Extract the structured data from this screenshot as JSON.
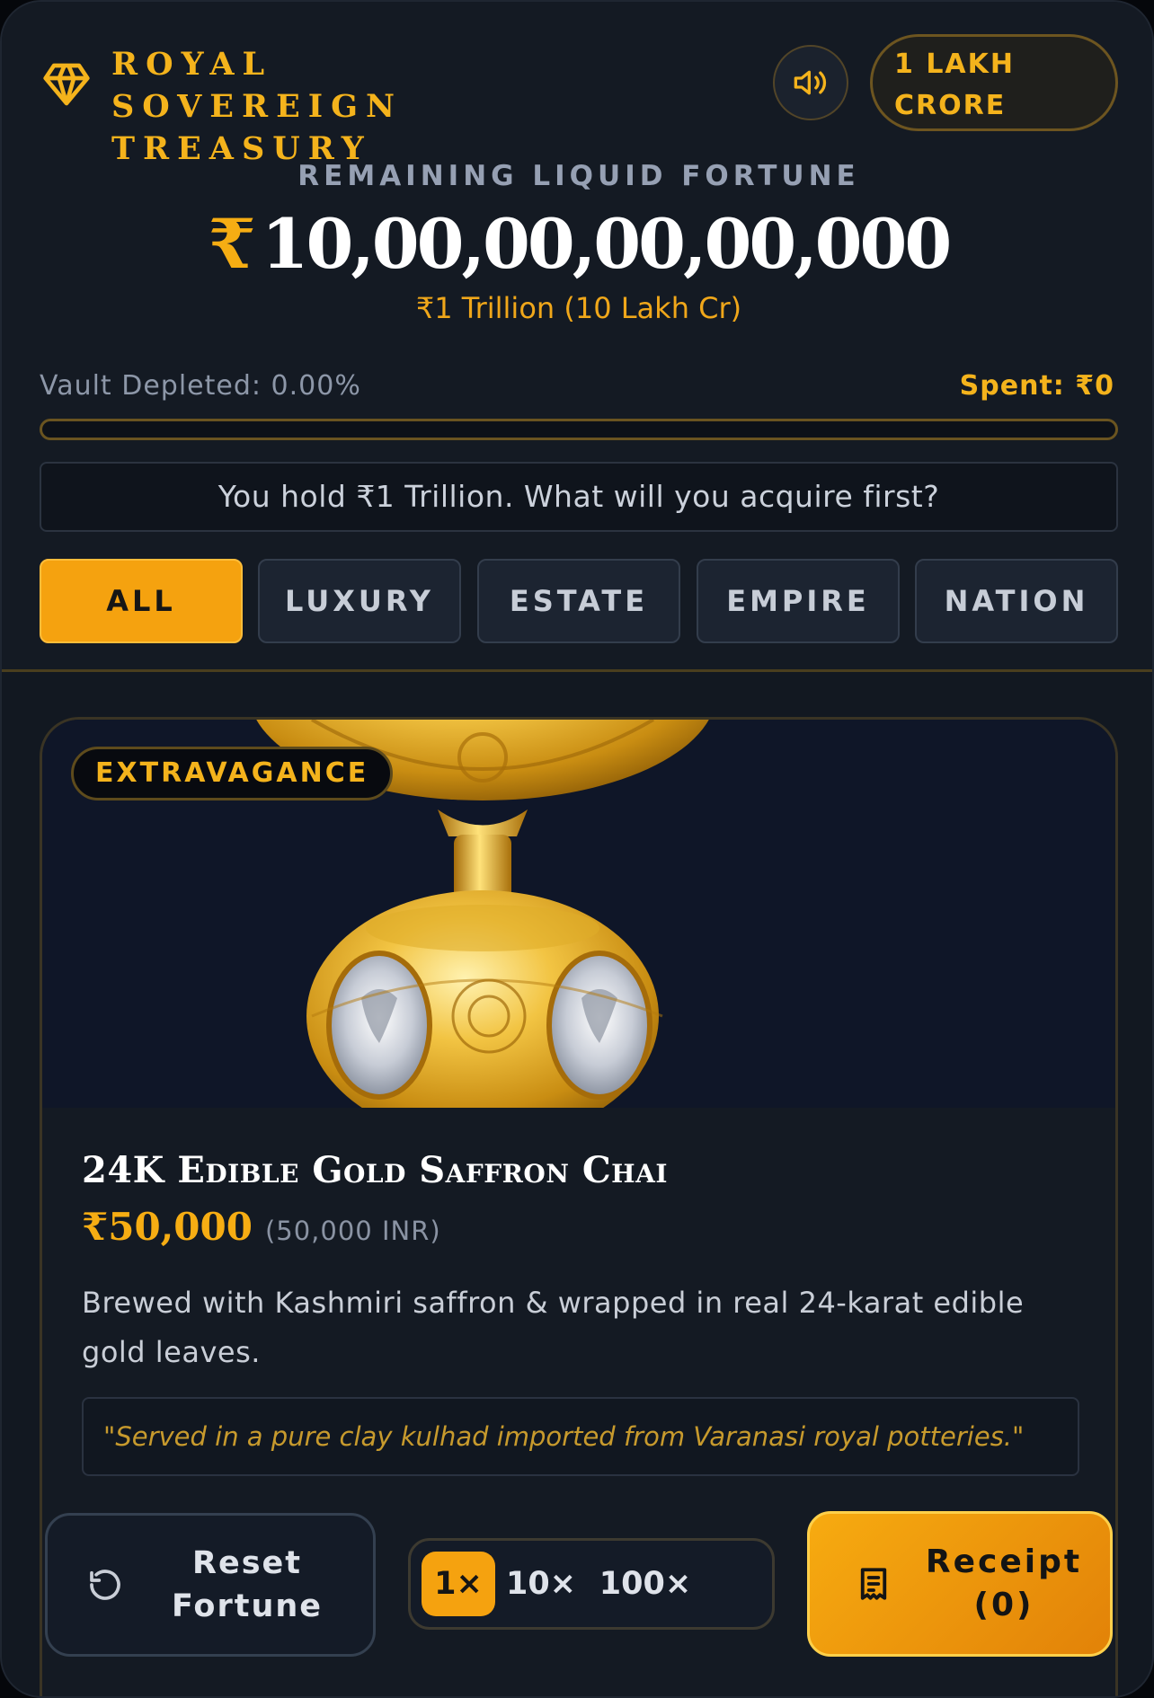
{
  "header": {
    "brand_title": "ROYAL SOVEREIGN TREASURY",
    "brand_icon": "diamond-icon",
    "sound_icon": "speaker-icon",
    "denomination_badge": "1 LAKH CRORE"
  },
  "fortune": {
    "label": "REMAINING LIQUID FORTUNE",
    "currency_symbol": "₹",
    "amount": "10,00,00,00,00,000",
    "subtitle": "₹1 Trillion (10 Lakh Cr)"
  },
  "vault": {
    "depleted_label": "Vault Depleted: 0.00%",
    "depleted_fraction": 0.0,
    "spent_label": "Spent: ₹0"
  },
  "prompt": "You hold ₹1 Trillion. What will you acquire first?",
  "tabs": [
    {
      "label": "ALL",
      "active": true
    },
    {
      "label": "LUXURY",
      "active": false
    },
    {
      "label": "ESTATE",
      "active": false
    },
    {
      "label": "EMPIRE",
      "active": false
    },
    {
      "label": "NATION",
      "active": false
    }
  ],
  "item": {
    "tag": "EXTRAVAGANCE",
    "title": "24K Edible Gold Saffron Chai",
    "price": "₹50,000",
    "price_inr": "(50,000 INR)",
    "description": "Brewed with Kashmiri saffron & wrapped in real 24-karat edible gold leaves.",
    "quote": "\"Served in a pure clay kulhad imported from Varanasi royal potteries.\""
  },
  "footer": {
    "reset_label": "Reset Fortune",
    "reset_icon": "rotate-ccw-icon",
    "multipliers": [
      {
        "label": "1×",
        "active": true
      },
      {
        "label": "10×",
        "active": false
      },
      {
        "label": "100×",
        "active": false
      }
    ],
    "receipt_label": "Receipt (0)",
    "receipt_icon": "receipt-icon"
  },
  "colors": {
    "accent": "#f5a20f",
    "background": "#121821",
    "card_image_bg": "#0f1628"
  }
}
